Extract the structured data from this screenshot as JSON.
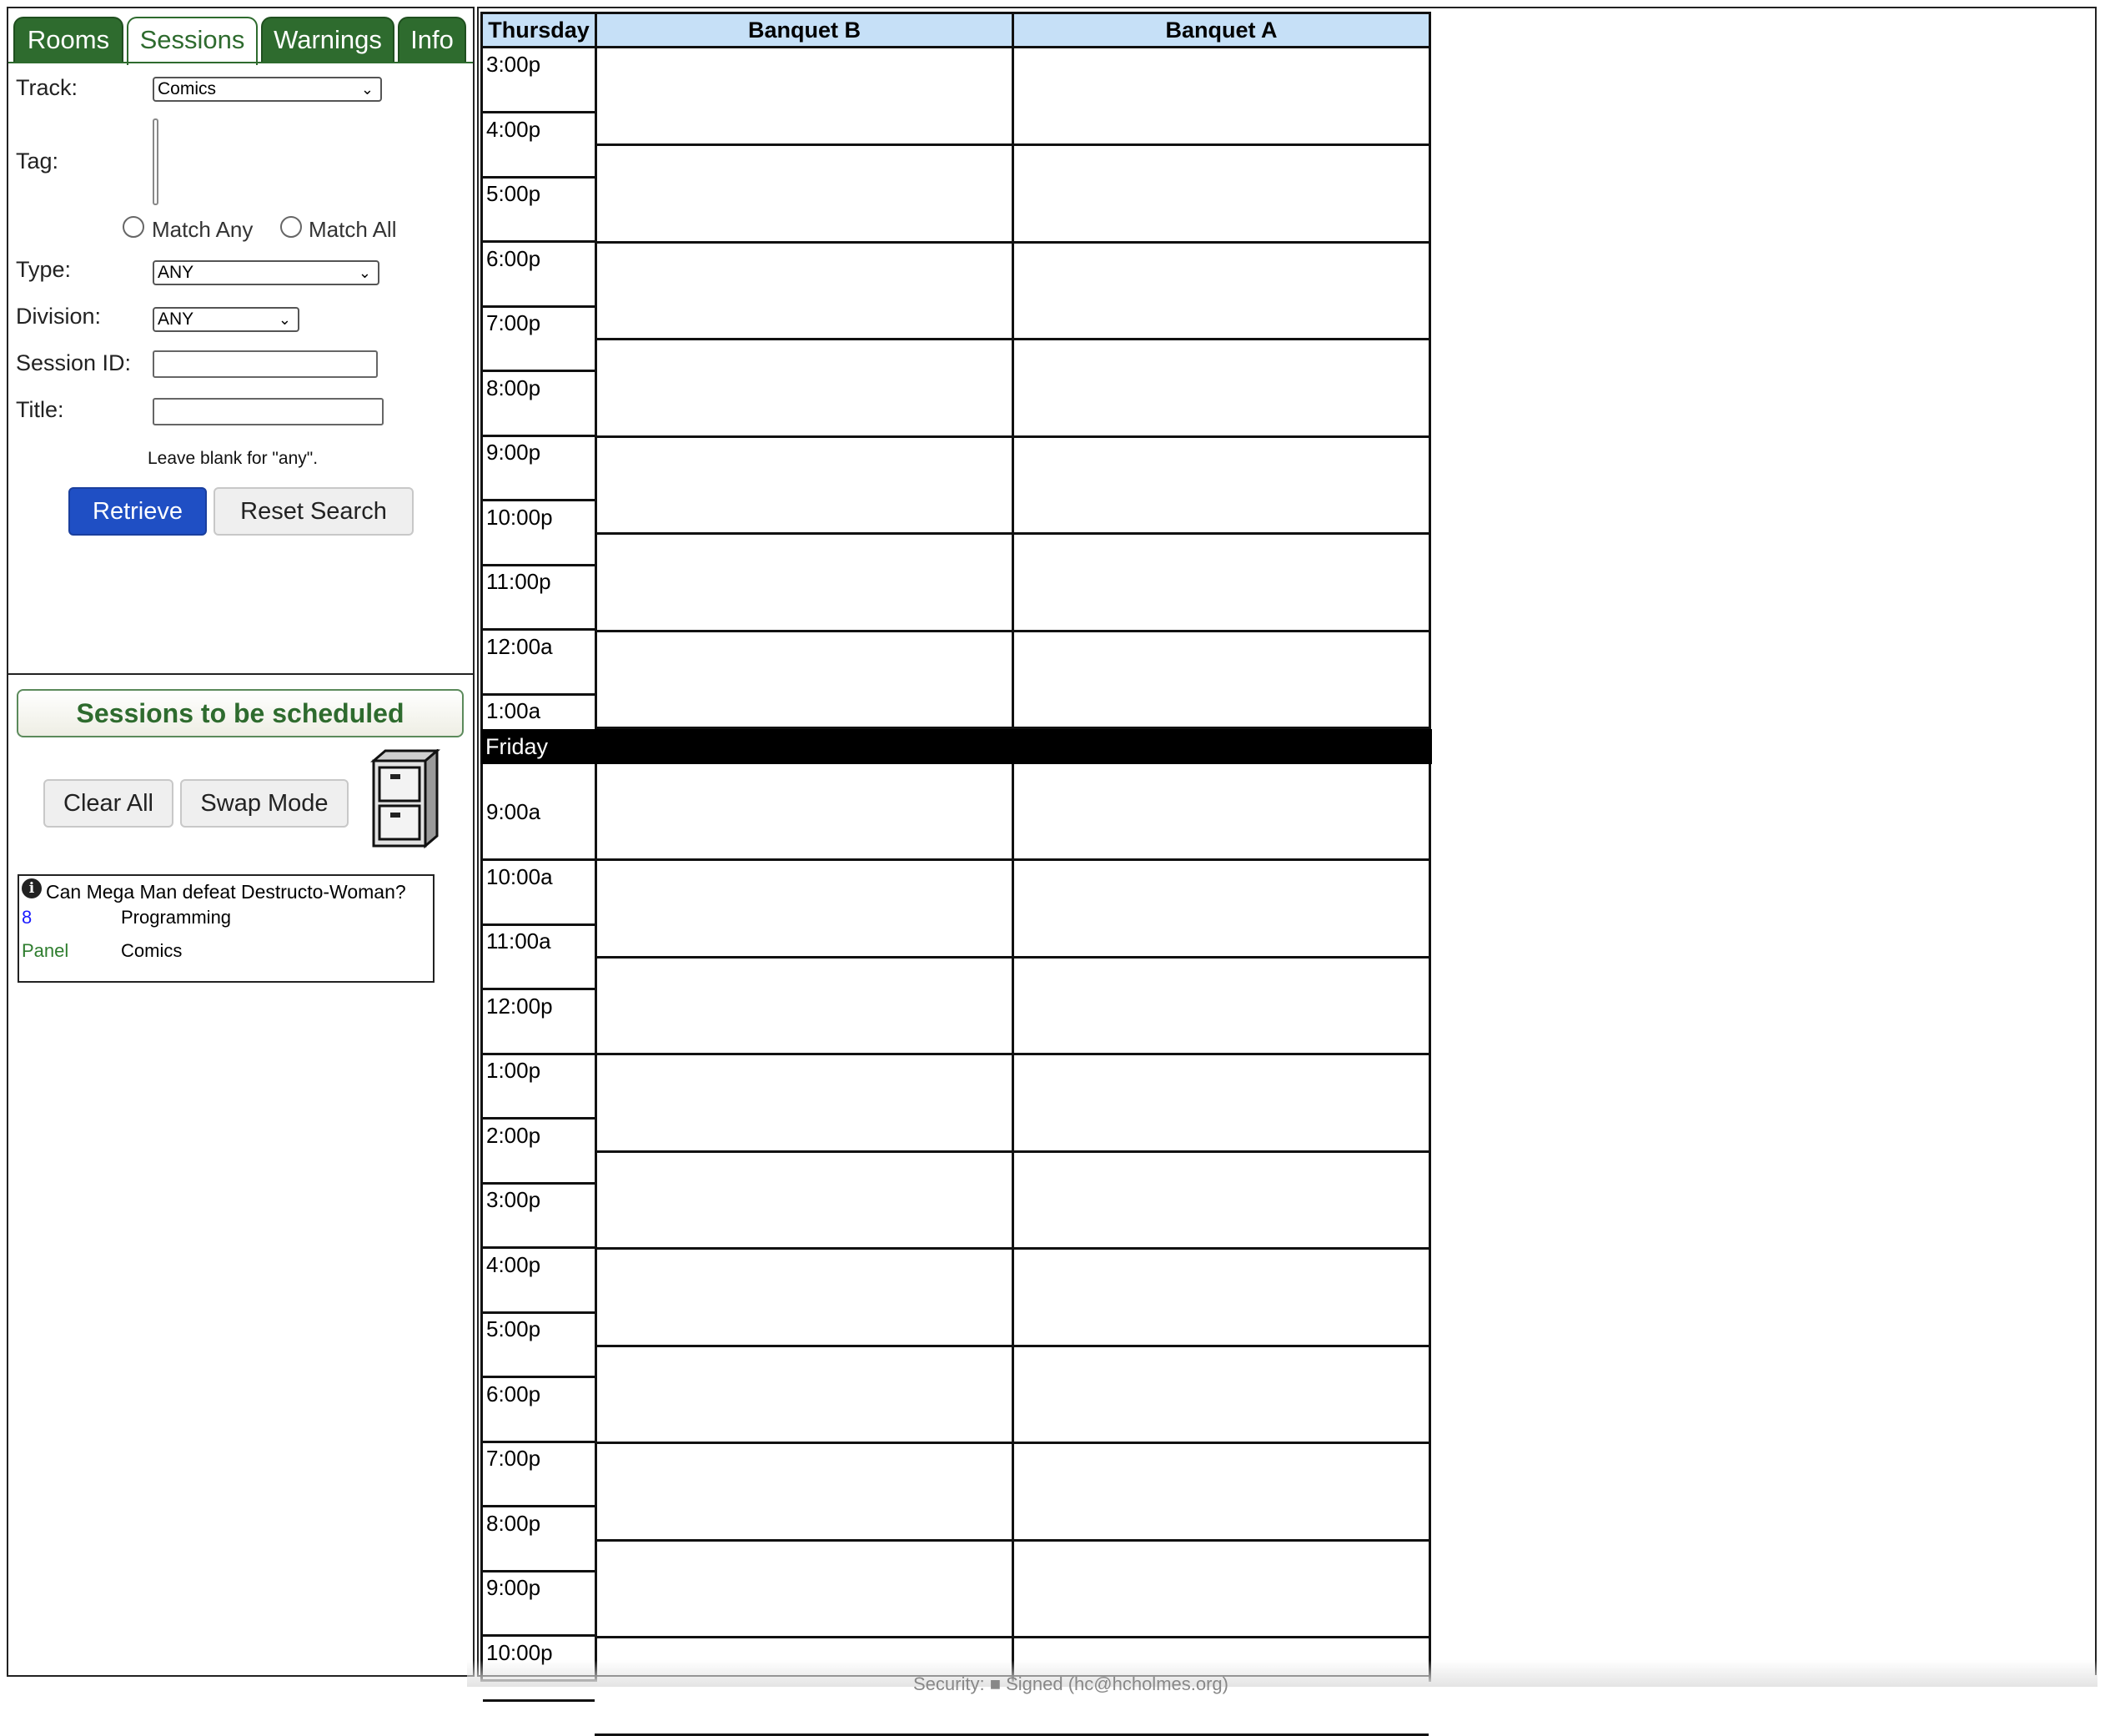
{
  "tabs": [
    {
      "label": "Rooms"
    },
    {
      "label": "Sessions"
    },
    {
      "label": "Warnings"
    },
    {
      "label": "Info"
    }
  ],
  "search": {
    "track_label": "Track:",
    "track_value": "Comics",
    "tag_label": "Tag:",
    "match_any_label": "Match Any",
    "match_all_label": "Match All",
    "type_label": "Type:",
    "type_value": "ANY",
    "division_label": "Division:",
    "division_value": "ANY",
    "session_id_label": "Session ID:",
    "session_id_value": "",
    "title_label": "Title:",
    "title_value": "",
    "hint": "Leave blank for \"any\".",
    "retrieve_label": "Retrieve",
    "reset_label": "Reset Search"
  },
  "unscheduled": {
    "header": "Sessions to be scheduled",
    "clear_all_label": "Clear All",
    "swap_mode_label": "Swap Mode",
    "sessions": [
      {
        "title": "Can Mega Man defeat Destructo-Woman?",
        "id": "8",
        "division": "Programming",
        "type": "Panel",
        "track": "Comics"
      }
    ]
  },
  "grid": {
    "day1": "Thursday",
    "rooms": [
      "Banquet B",
      "Banquet A"
    ],
    "day1_times": [
      "3:00p",
      "4:00p",
      "5:00p",
      "6:00p",
      "7:00p",
      "8:00p",
      "9:00p",
      "10:00p",
      "11:00p",
      "12:00a",
      "1:00a"
    ],
    "day2": "Friday",
    "day2_times": [
      "9:00a",
      "10:00a",
      "11:00a",
      "12:00p",
      "1:00p",
      "2:00p",
      "3:00p",
      "4:00p",
      "5:00p",
      "6:00p",
      "7:00p",
      "8:00p",
      "9:00p",
      "10:00p"
    ]
  },
  "footer": {
    "text": "Security: ■ Signed (hc@hcholmes.org)"
  },
  "colors": {
    "tab_green": "#2e6b2e",
    "primary_blue": "#1f4fc4",
    "header_blue": "#c6e0f7"
  }
}
